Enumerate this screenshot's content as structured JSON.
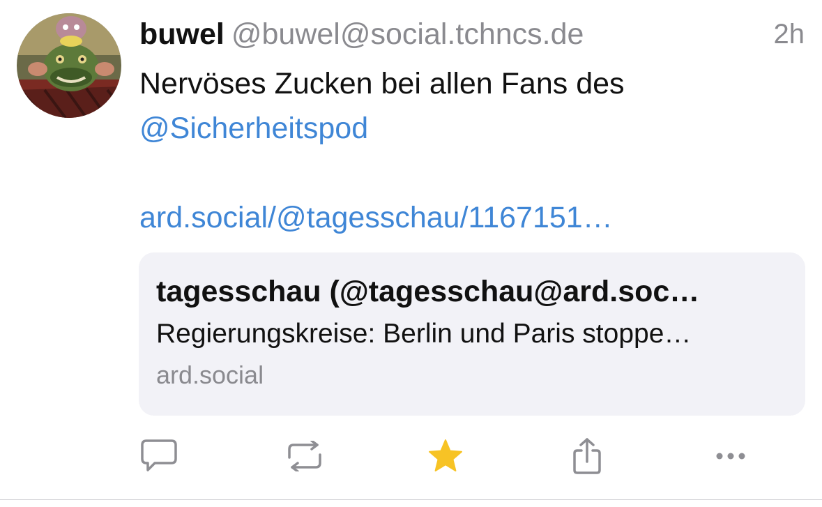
{
  "post": {
    "display_name": "buwel",
    "handle": "@buwel@social.tchncs.de",
    "time": "2h",
    "text_line1": "Nervöses Zucken bei allen Fans des",
    "mention": "@Sicherheitspod",
    "link": "ard.social/@tagesschau/1167151…"
  },
  "card": {
    "title": "tagesschau (@tagesschau@ard.soc…",
    "description": "Regierungskreise: Berlin und Paris stoppe…",
    "domain": "ard.social"
  },
  "actions": [
    {
      "name": "reply",
      "icon": "speech-bubble-icon"
    },
    {
      "name": "boost",
      "icon": "repost-icon"
    },
    {
      "name": "favourite",
      "icon": "star-icon",
      "active": true
    },
    {
      "name": "share",
      "icon": "share-icon"
    },
    {
      "name": "more",
      "icon": "ellipsis-icon"
    }
  ],
  "colors": {
    "link": "#3f86d6",
    "secondary_text": "#8a8a8f",
    "icon_gray": "#8e8e93",
    "favourite_active": "#f7c325",
    "card_background": "#f2f2f7"
  }
}
